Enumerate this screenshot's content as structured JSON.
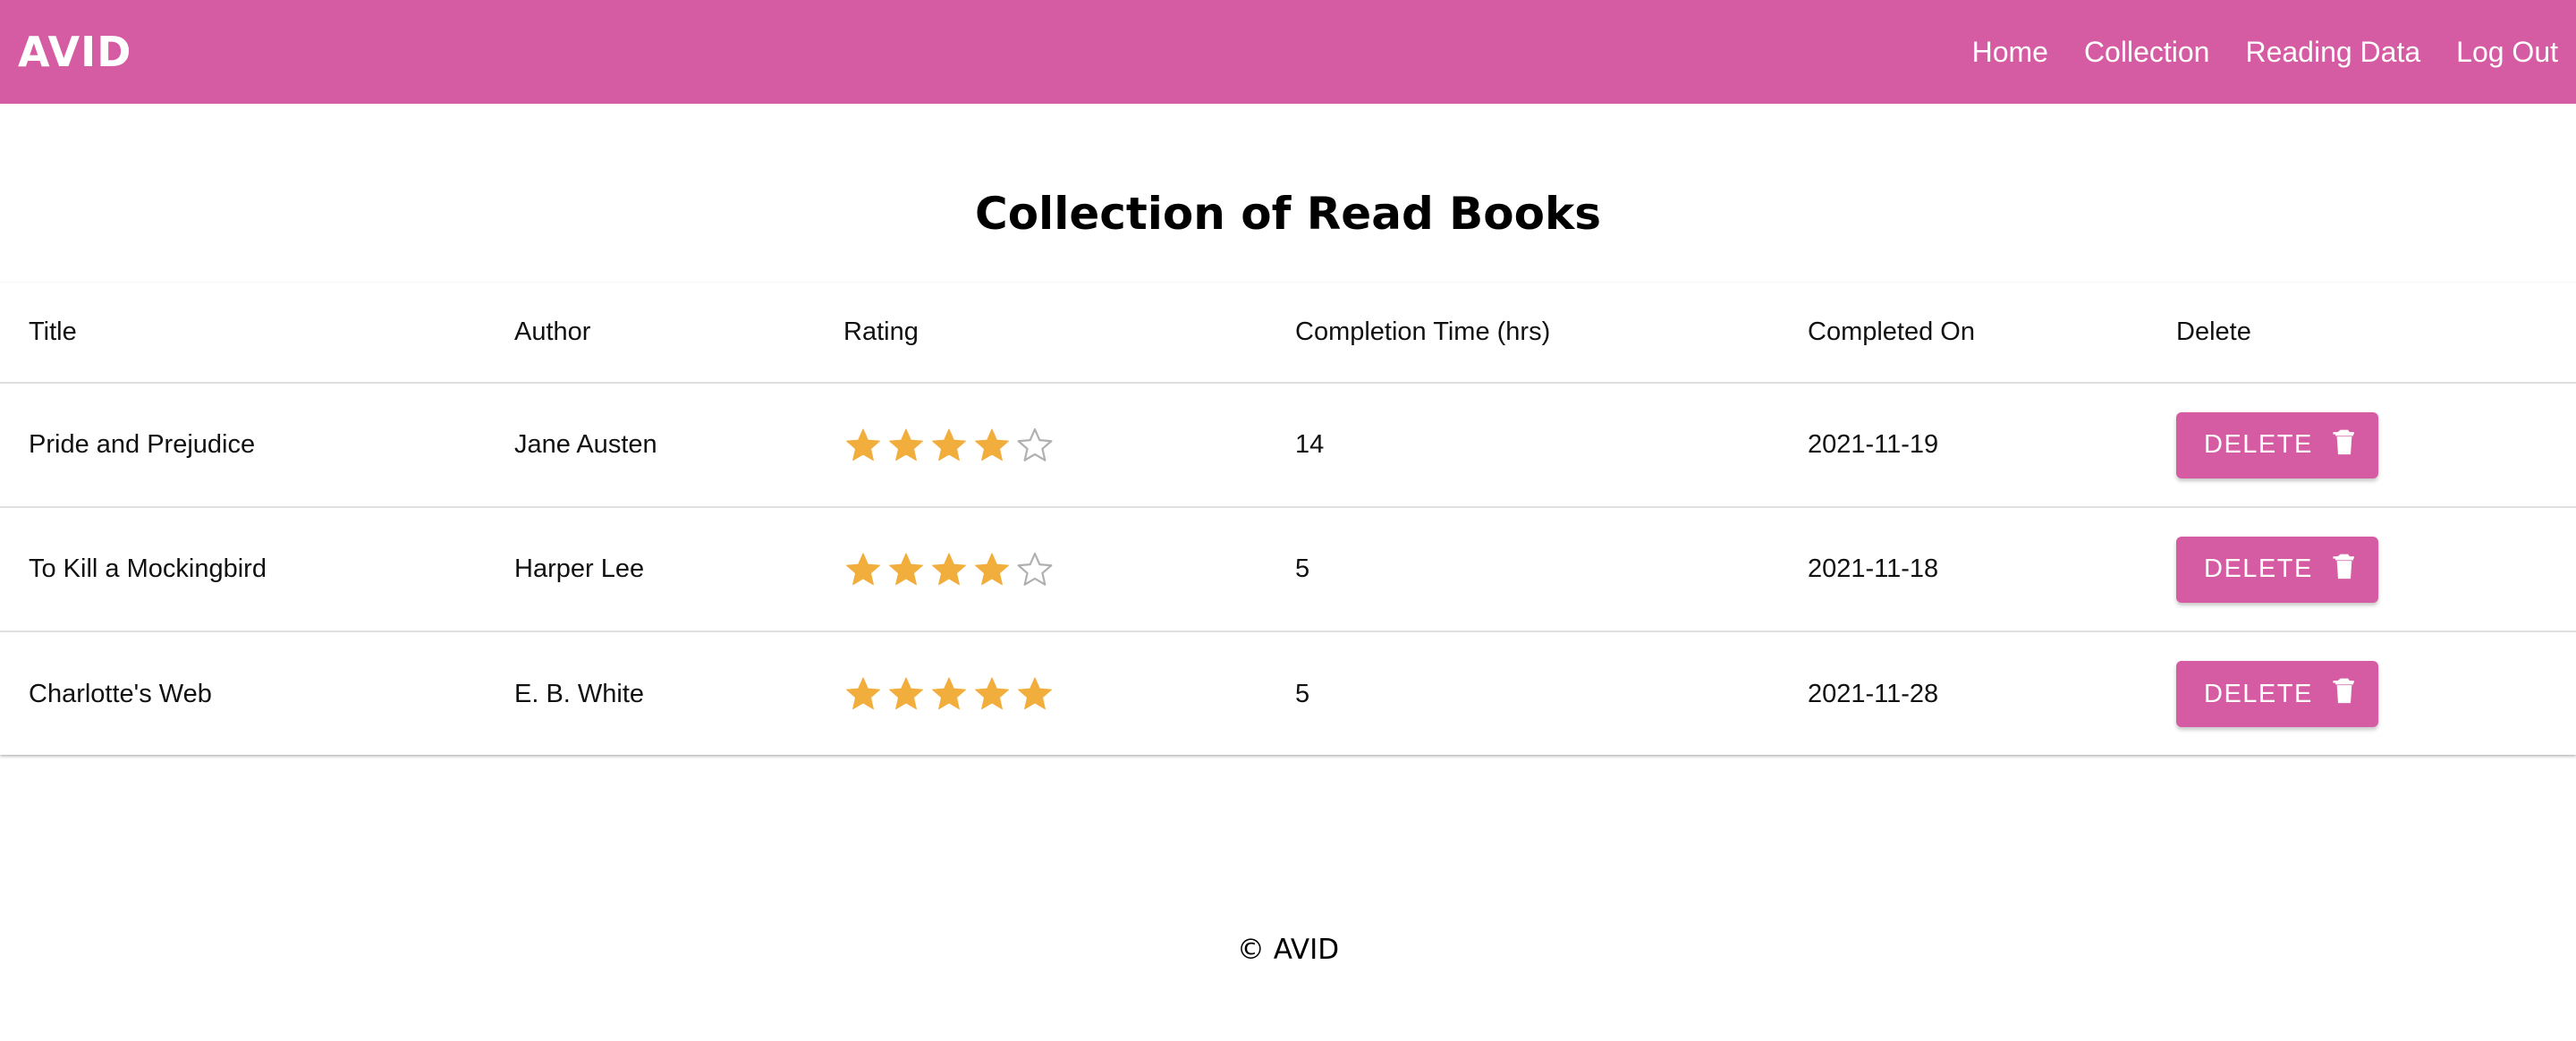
{
  "nav": {
    "brand": "AVID",
    "links": [
      "Home",
      "Collection",
      "Reading Data",
      "Log Out"
    ]
  },
  "page": {
    "title": "Collection of Read Books"
  },
  "table": {
    "headers": [
      "Title",
      "Author",
      "Rating",
      "Completion Time (hrs)",
      "Completed On",
      "Delete"
    ],
    "rows": [
      {
        "title": "Pride and Prejudice",
        "author": "Jane Austen",
        "rating": 4,
        "max_rating": 5,
        "hours": "14",
        "completed_on": "2021-11-19",
        "delete_label": "DELETE"
      },
      {
        "title": "To Kill a Mockingbird",
        "author": "Harper Lee",
        "rating": 4,
        "max_rating": 5,
        "hours": "5",
        "completed_on": "2021-11-18",
        "delete_label": "DELETE"
      },
      {
        "title": "Charlotte's Web",
        "author": "E. B. White",
        "rating": 5,
        "max_rating": 5,
        "hours": "5",
        "completed_on": "2021-11-28",
        "delete_label": "DELETE"
      }
    ]
  },
  "icons": {
    "star_filled": "star-icon",
    "star_empty": "star-outline-icon",
    "trash": "trash-icon"
  },
  "footer": {
    "text": "© AVID"
  },
  "colors": {
    "brand": "#d55ca3",
    "star": "#f2ae3d",
    "star_empty": "#b0b0b0"
  }
}
